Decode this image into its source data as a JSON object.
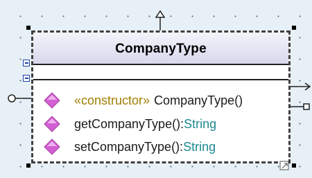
{
  "class": {
    "name": "CompanyType",
    "operations": [
      {
        "stereotype": "«constructor»",
        "name": "CompanyType()",
        "type": ""
      },
      {
        "stereotype": "",
        "name": "getCompanyType():",
        "type": "String"
      },
      {
        "stereotype": "",
        "name": "setCompanyType():",
        "type": "String"
      }
    ]
  },
  "icons": {
    "operation": "operation-diamond-icon",
    "attributes_toggle": "collapse-compartment-icon",
    "operations_toggle": "collapse-compartment-icon",
    "generalization": "generalization-arrow-icon",
    "interface": "provided-interface-icon",
    "association": "association-arrow-icon",
    "port": "port-icon",
    "resize": "resize-grip-icon"
  },
  "colors": {
    "canvas": "#e6f0f6",
    "header_top": "#f4f4fb",
    "header_bottom": "#d6d6ec",
    "operation_icon": "#d35fd3",
    "stereotype": "#a07d00",
    "type": "#1f8a91",
    "toggle": "#1d3fa8"
  }
}
